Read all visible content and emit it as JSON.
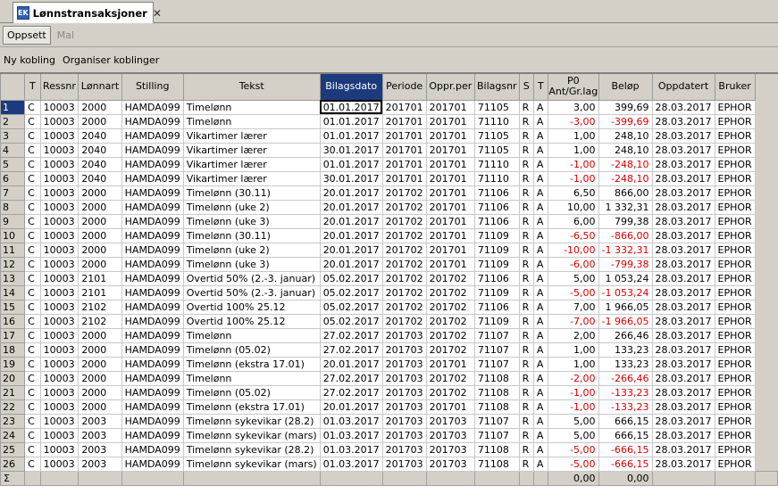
{
  "tab": {
    "icon": "EK",
    "title": "Lønnstransaksjoner",
    "close": "✕"
  },
  "toolbar1": {
    "oppsett": "Oppsett",
    "mal": "Mal"
  },
  "toolbar2": {
    "ny_kobling": "Ny kobling",
    "organiser": "Organiser koblinger"
  },
  "columns": [
    "",
    "T",
    "Ressnr",
    "Lønnart",
    "Stilling",
    "Tekst",
    "Bilagsdato",
    "Periode",
    "Oppr.per",
    "Bilagsnr",
    "S",
    "T",
    "P0\nAnt/Gr.lag",
    "Beløp",
    "Oppdatert",
    "Bruker"
  ],
  "rows": [
    [
      "1",
      "C",
      "10003",
      "2000",
      "HAMDA099",
      "Timelønn",
      "01.01.2017",
      "201701",
      "201701",
      "71105",
      "R",
      "A",
      "3,00",
      "399,69",
      "28.03.2017",
      "EPHOR"
    ],
    [
      "2",
      "C",
      "10003",
      "2000",
      "HAMDA099",
      "Timelønn",
      "01.01.2017",
      "201701",
      "201701",
      "71110",
      "R",
      "A",
      "-3,00",
      "-399,69",
      "28.03.2017",
      "EPHOR"
    ],
    [
      "3",
      "C",
      "10003",
      "2040",
      "HAMDA099",
      "Vikartimer lærer",
      "01.01.2017",
      "201701",
      "201701",
      "71105",
      "R",
      "A",
      "1,00",
      "248,10",
      "28.03.2017",
      "EPHOR"
    ],
    [
      "4",
      "C",
      "10003",
      "2040",
      "HAMDA099",
      "Vikartimer lærer",
      "30.01.2017",
      "201701",
      "201701",
      "71105",
      "R",
      "A",
      "1,00",
      "248,10",
      "28.03.2017",
      "EPHOR"
    ],
    [
      "5",
      "C",
      "10003",
      "2040",
      "HAMDA099",
      "Vikartimer lærer",
      "01.01.2017",
      "201701",
      "201701",
      "71110",
      "R",
      "A",
      "-1,00",
      "-248,10",
      "28.03.2017",
      "EPHOR"
    ],
    [
      "6",
      "C",
      "10003",
      "2040",
      "HAMDA099",
      "Vikartimer lærer",
      "30.01.2017",
      "201701",
      "201701",
      "71110",
      "R",
      "A",
      "-1,00",
      "-248,10",
      "28.03.2017",
      "EPHOR"
    ],
    [
      "7",
      "C",
      "10003",
      "2000",
      "HAMDA099",
      "Timelønn (30.11)",
      "20.01.2017",
      "201702",
      "201701",
      "71106",
      "R",
      "A",
      "6,50",
      "866,00",
      "28.03.2017",
      "EPHOR"
    ],
    [
      "8",
      "C",
      "10003",
      "2000",
      "HAMDA099",
      "Timelønn (uke 2)",
      "20.01.2017",
      "201702",
      "201701",
      "71106",
      "R",
      "A",
      "10,00",
      "1 332,31",
      "28.03.2017",
      "EPHOR"
    ],
    [
      "9",
      "C",
      "10003",
      "2000",
      "HAMDA099",
      "Timelønn (uke 3)",
      "20.01.2017",
      "201702",
      "201701",
      "71106",
      "R",
      "A",
      "6,00",
      "799,38",
      "28.03.2017",
      "EPHOR"
    ],
    [
      "10",
      "C",
      "10003",
      "2000",
      "HAMDA099",
      "Timelønn (30.11)",
      "20.01.2017",
      "201702",
      "201701",
      "71109",
      "R",
      "A",
      "-6,50",
      "-866,00",
      "28.03.2017",
      "EPHOR"
    ],
    [
      "11",
      "C",
      "10003",
      "2000",
      "HAMDA099",
      "Timelønn (uke 2)",
      "20.01.2017",
      "201702",
      "201701",
      "71109",
      "R",
      "A",
      "-10,00",
      "-1 332,31",
      "28.03.2017",
      "EPHOR"
    ],
    [
      "12",
      "C",
      "10003",
      "2000",
      "HAMDA099",
      "Timelønn (uke 3)",
      "20.01.2017",
      "201702",
      "201701",
      "71109",
      "R",
      "A",
      "-6,00",
      "-799,38",
      "28.03.2017",
      "EPHOR"
    ],
    [
      "13",
      "C",
      "10003",
      "2101",
      "HAMDA099",
      "Overtid 50% (2.-3. januar)",
      "05.02.2017",
      "201702",
      "201702",
      "71106",
      "R",
      "A",
      "5,00",
      "1 053,24",
      "28.03.2017",
      "EPHOR"
    ],
    [
      "14",
      "C",
      "10003",
      "2101",
      "HAMDA099",
      "Overtid 50% (2.-3. januar)",
      "05.02.2017",
      "201702",
      "201702",
      "71109",
      "R",
      "A",
      "-5,00",
      "-1 053,24",
      "28.03.2017",
      "EPHOR"
    ],
    [
      "15",
      "C",
      "10003",
      "2102",
      "HAMDA099",
      "Overtid 100% 25.12",
      "05.02.2017",
      "201702",
      "201702",
      "71106",
      "R",
      "A",
      "7,00",
      "1 966,05",
      "28.03.2017",
      "EPHOR"
    ],
    [
      "16",
      "C",
      "10003",
      "2102",
      "HAMDA099",
      "Overtid 100% 25.12",
      "05.02.2017",
      "201702",
      "201702",
      "71109",
      "R",
      "A",
      "-7,00",
      "-1 966,05",
      "28.03.2017",
      "EPHOR"
    ],
    [
      "17",
      "C",
      "10003",
      "2000",
      "HAMDA099",
      "Timelønn",
      "27.02.2017",
      "201703",
      "201702",
      "71107",
      "R",
      "A",
      "2,00",
      "266,46",
      "28.03.2017",
      "EPHOR"
    ],
    [
      "18",
      "C",
      "10003",
      "2000",
      "HAMDA099",
      "Timelønn (05.02)",
      "27.02.2017",
      "201703",
      "201702",
      "71107",
      "R",
      "A",
      "1,00",
      "133,23",
      "28.03.2017",
      "EPHOR"
    ],
    [
      "19",
      "C",
      "10003",
      "2000",
      "HAMDA099",
      "Timelønn (ekstra 17.01)",
      "20.01.2017",
      "201703",
      "201701",
      "71107",
      "R",
      "A",
      "1,00",
      "133,23",
      "28.03.2017",
      "EPHOR"
    ],
    [
      "20",
      "C",
      "10003",
      "2000",
      "HAMDA099",
      "Timelønn",
      "27.02.2017",
      "201703",
      "201702",
      "71108",
      "R",
      "A",
      "-2,00",
      "-266,46",
      "28.03.2017",
      "EPHOR"
    ],
    [
      "21",
      "C",
      "10003",
      "2000",
      "HAMDA099",
      "Timelønn (05.02)",
      "27.02.2017",
      "201703",
      "201702",
      "71108",
      "R",
      "A",
      "-1,00",
      "-133,23",
      "28.03.2017",
      "EPHOR"
    ],
    [
      "22",
      "C",
      "10003",
      "2000",
      "HAMDA099",
      "Timelønn (ekstra 17.01)",
      "20.01.2017",
      "201703",
      "201701",
      "71108",
      "R",
      "A",
      "-1,00",
      "-133,23",
      "28.03.2017",
      "EPHOR"
    ],
    [
      "23",
      "C",
      "10003",
      "2003",
      "HAMDA099",
      "Timelønn sykevikar (28.2)",
      "01.03.2017",
      "201703",
      "201703",
      "71107",
      "R",
      "A",
      "5,00",
      "666,15",
      "28.03.2017",
      "EPHOR"
    ],
    [
      "24",
      "C",
      "10003",
      "2003",
      "HAMDA099",
      "Timelønn sykevikar (mars)",
      "01.03.2017",
      "201703",
      "201703",
      "71107",
      "R",
      "A",
      "5,00",
      "666,15",
      "28.03.2017",
      "EPHOR"
    ],
    [
      "25",
      "C",
      "10003",
      "2003",
      "HAMDA099",
      "Timelønn sykevikar (28.2)",
      "01.03.2017",
      "201703",
      "201703",
      "71108",
      "R",
      "A",
      "-5,00",
      "-666,15",
      "28.03.2017",
      "EPHOR"
    ],
    [
      "26",
      "C",
      "10003",
      "2003",
      "HAMDA099",
      "Timelønn sykevikar (mars)",
      "01.03.2017",
      "201703",
      "201703",
      "71108",
      "R",
      "A",
      "-5,00",
      "-666,15",
      "28.03.2017",
      "EPHOR"
    ]
  ],
  "summary": {
    "label": "Σ",
    "ant": "0,00",
    "belop": "0,00"
  },
  "colors": {
    "selection": "#1c3a7c",
    "negative": "#d40000"
  }
}
